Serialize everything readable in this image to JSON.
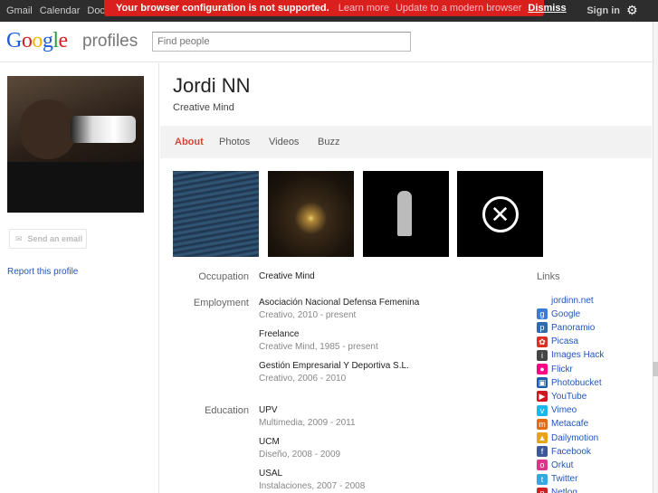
{
  "topbar": {
    "nav": [
      "Gmail",
      "Calendar",
      "Docu"
    ],
    "signin": "Sign in",
    "warning": {
      "message": "Your browser configuration is not supported.",
      "learn_more": "Learn more",
      "update": "Update to a modern browser",
      "dismiss": "Dismiss"
    }
  },
  "header": {
    "product": "profiles",
    "search_placeholder": "Find people"
  },
  "profile": {
    "name": "Jordi NN",
    "tagline": "Creative Mind",
    "send_email": "Send an email",
    "report": "Report this profile"
  },
  "tabs": [
    "About",
    "Photos",
    "Videos",
    "Buzz"
  ],
  "about": {
    "occupation_label": "Occupation",
    "occupation": "Creative Mind",
    "employment_label": "Employment",
    "employment": [
      {
        "name": "Asociación Nacional Defensa Femenina",
        "detail": "Creativo, 2010 - present"
      },
      {
        "name": "Freelance",
        "detail": "Creative Mind, 1985 - present"
      },
      {
        "name": "Gestión Empresarial Y Deportiva S.L.",
        "detail": "Creativo, 2006 - 2010"
      }
    ],
    "education_label": "Education",
    "education": [
      {
        "name": "UPV",
        "detail": "Multimedia, 2009 - 2011"
      },
      {
        "name": "UCM",
        "detail": "Diseño, 2008 - 2009"
      },
      {
        "name": "USAL",
        "detail": "Instalaciones, 2007 - 2008"
      }
    ]
  },
  "links": {
    "heading": "Links",
    "items": [
      {
        "label": "jordinn.net",
        "icon": "none",
        "color": ""
      },
      {
        "label": "Google",
        "icon": "google-icon",
        "color": "#3a7bd5"
      },
      {
        "label": "Panoramio",
        "icon": "panoramio-icon",
        "color": "#2b6cb0"
      },
      {
        "label": "Picasa",
        "icon": "picasa-icon",
        "color": "#d93025"
      },
      {
        "label": "Images Hack",
        "icon": "imageshack-icon",
        "color": "#444444"
      },
      {
        "label": "Flickr",
        "icon": "flickr-icon",
        "color": "#ff0084"
      },
      {
        "label": "Photobucket",
        "icon": "photobucket-icon",
        "color": "#1b5eb0"
      },
      {
        "label": "YouTube",
        "icon": "youtube-icon",
        "color": "#cc181e"
      },
      {
        "label": "Vimeo",
        "icon": "vimeo-icon",
        "color": "#1ab7ea"
      },
      {
        "label": "Metacafe",
        "icon": "metacafe-icon",
        "color": "#e26b1a"
      },
      {
        "label": "Dailymotion",
        "icon": "dailymotion-icon",
        "color": "#e8a317"
      },
      {
        "label": "Facebook",
        "icon": "facebook-icon",
        "color": "#3b5998"
      },
      {
        "label": "Orkut",
        "icon": "orkut-icon",
        "color": "#d9368b"
      },
      {
        "label": "Twitter",
        "icon": "twitter-icon",
        "color": "#33aadd"
      },
      {
        "label": "Netlog",
        "icon": "netlog-icon",
        "color": "#cc2222"
      }
    ]
  }
}
